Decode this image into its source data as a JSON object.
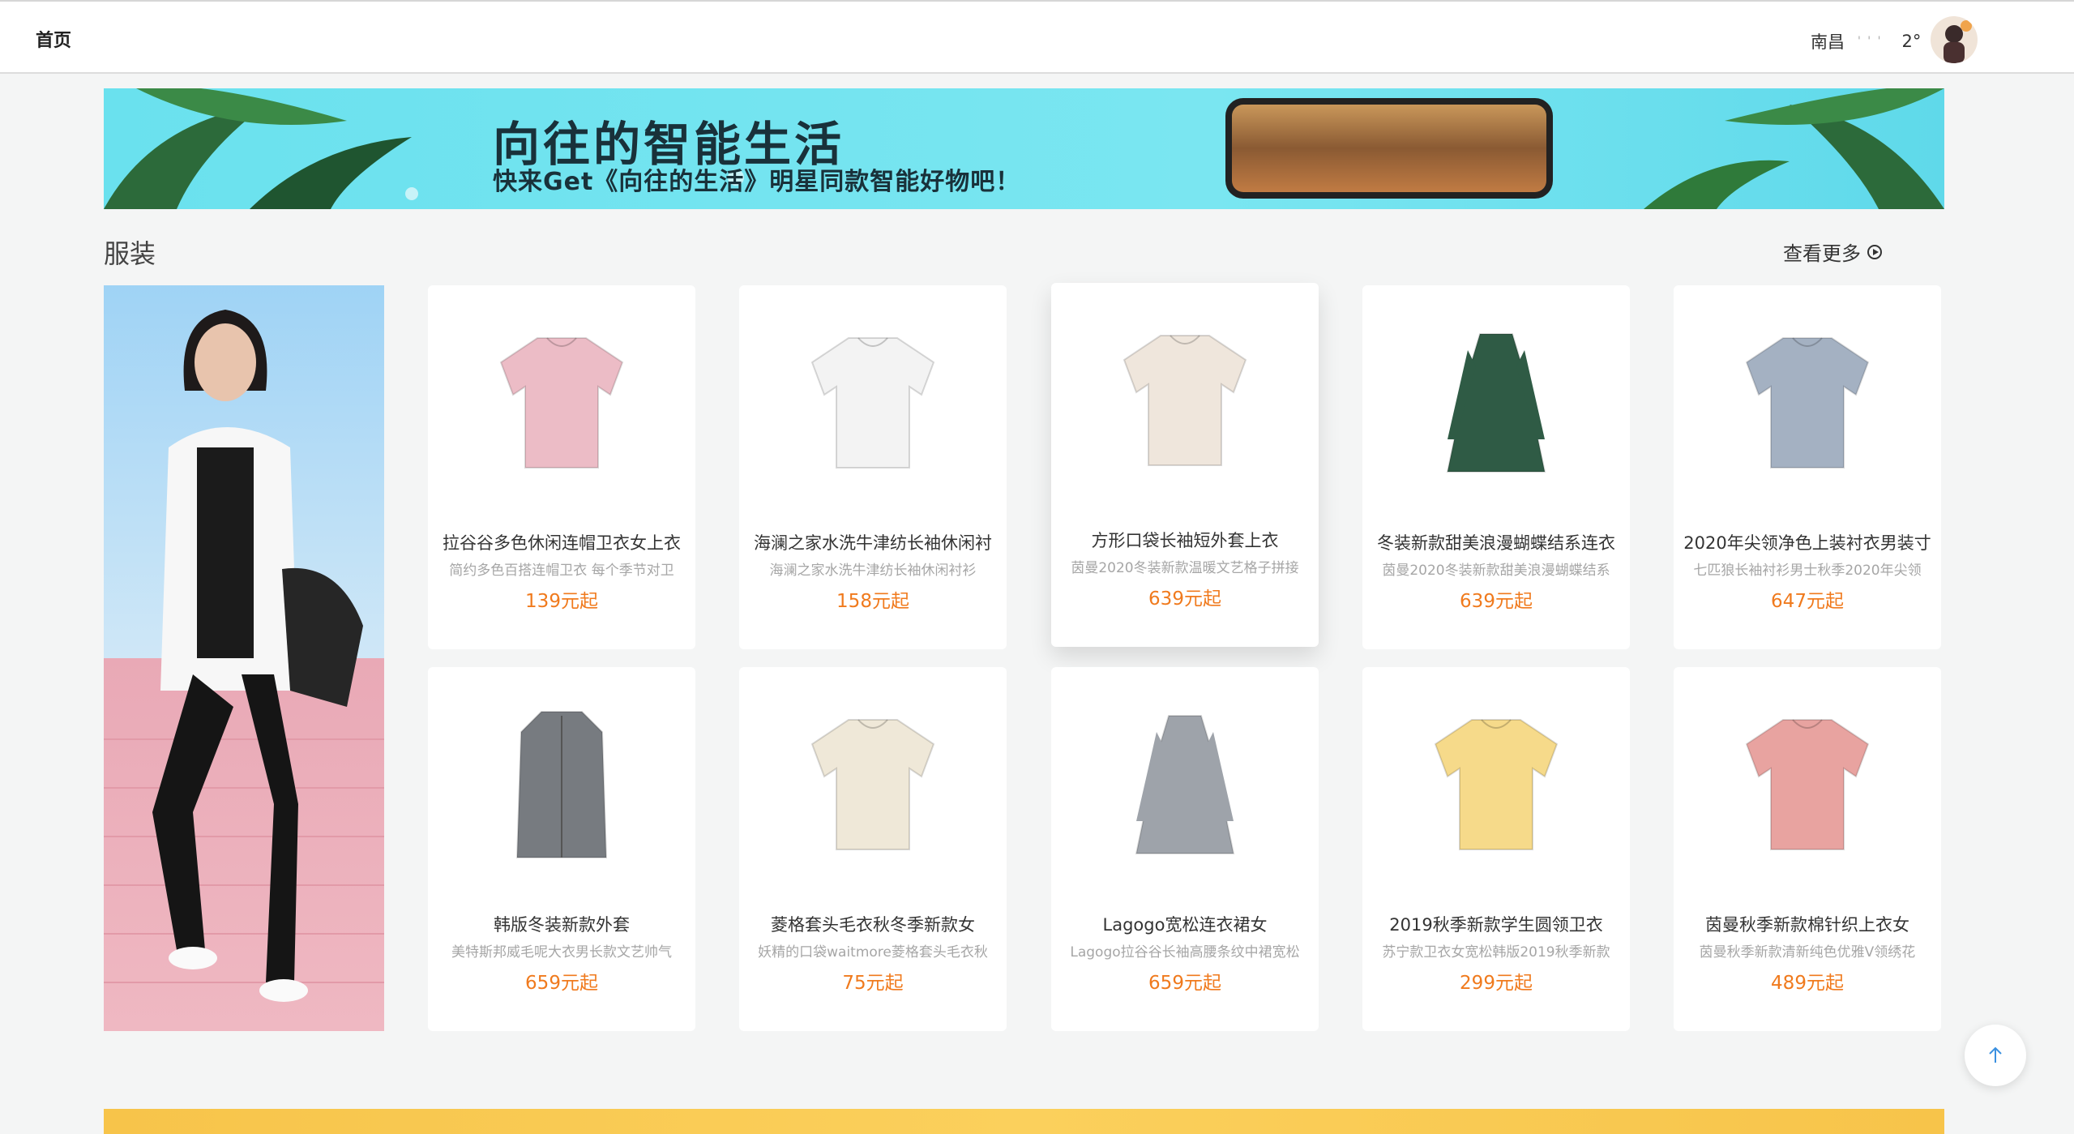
{
  "nav": {
    "home": "首页"
  },
  "weather": {
    "city": "南昌",
    "temp": "2°"
  },
  "banner": {
    "title": "向往的智能生活",
    "subtitle": "快来Get《向往的生活》明星同款智能好物吧！"
  },
  "section": {
    "title": "服装",
    "more": "查看更多"
  },
  "products": [
    {
      "name": "拉谷谷多色休闲连帽卫衣女上衣",
      "desc": "简约多色百搭连帽卫衣 每个季节对卫",
      "price": "139元起",
      "icon": "pink-hoodie",
      "color": "#ecbcc6"
    },
    {
      "name": "海澜之家水洗牛津纺长袖休闲衬",
      "desc": "海澜之家水洗牛津纺长袖休闲衬衫",
      "price": "158元起",
      "icon": "white-shirt",
      "color": "#f3f3f3"
    },
    {
      "name": "方形口袋长袖短外套上衣",
      "desc": "茵曼2020冬装新款温暖文艺格子拼接",
      "price": "639元起",
      "icon": "cream-jacket",
      "color": "#efe6dc"
    },
    {
      "name": "冬装新款甜美浪漫蝴蝶结系连衣",
      "desc": "茵曼2020冬装新款甜美浪漫蝴蝶结系",
      "price": "639元起",
      "icon": "plaid-dress",
      "color": "#2f5b45"
    },
    {
      "name": "2020年尖领净色上装衬衣男装寸",
      "desc": "七匹狼长袖衬衫男士秋季2020年尖领",
      "price": "647元起",
      "icon": "blue-shirt",
      "color": "#a4b1c2"
    },
    {
      "name": "韩版冬装新款外套",
      "desc": "美特斯邦威毛呢大衣男长款文艺帅气",
      "price": "659元起",
      "icon": "gray-coat",
      "color": "#777b80"
    },
    {
      "name": "菱格套头毛衣秋冬季新款女",
      "desc": "妖精的口袋waitmore菱格套头毛衣秋",
      "price": "75元起",
      "icon": "argyle-sweater",
      "color": "#efe8d8"
    },
    {
      "name": "Lagogo宽松连衣裙女",
      "desc": "Lagogo拉谷谷长袖高腰条纹中裙宽松",
      "price": "659元起",
      "icon": "striped-dress",
      "color": "#9ea3aa"
    },
    {
      "name": "2019秋季新款学生圆领卫衣",
      "desc": "苏宁款卫衣女宽松韩版2019秋季新款",
      "price": "299元起",
      "icon": "yellow-sweatshirt",
      "color": "#f6da8a"
    },
    {
      "name": "茵曼秋季新款棉针织上衣女",
      "desc": "茵曼秋季新款清新纯色优雅V领绣花",
      "price": "489元起",
      "icon": "pink-cardigan",
      "color": "#e8a3a0"
    }
  ]
}
